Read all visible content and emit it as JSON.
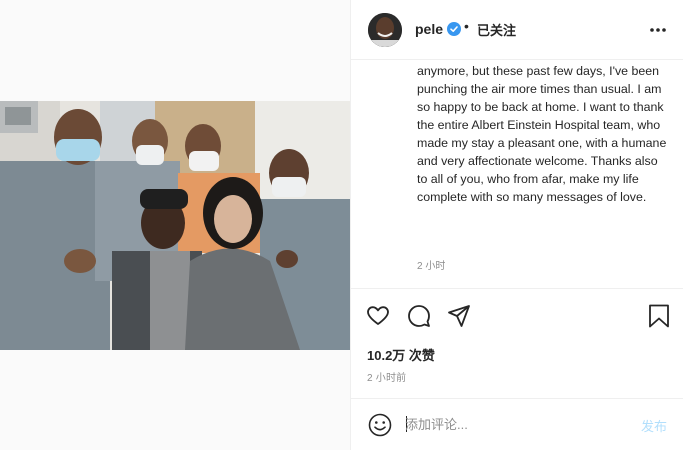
{
  "header": {
    "username": "pele",
    "separator": "•",
    "follow_status": "已关注"
  },
  "post": {
    "caption": "anymore, but these past few days, I've been punching the air more times than usual. I am so happy to be back at home. I want to thank the entire Albert Einstein Hospital team, who made my stay a pleasant one, with a humane and very affectionate welcome. Thanks also to all of you, who from afar, make my life complete with so many messages of love.",
    "caption_time": "2 小时",
    "likes": "10.2万 次赞",
    "posted_time": "2 小时前"
  },
  "comment": {
    "placeholder": "添加评论...",
    "post_label": "发布"
  },
  "icons": {
    "verified": "verified-badge-icon",
    "more": "more-options-icon",
    "like": "heart-icon",
    "comment": "comment-bubble-icon",
    "share": "paper-plane-icon",
    "save": "bookmark-icon",
    "emoji": "emoji-smile-icon"
  },
  "colors": {
    "verified_blue": "#3897f0",
    "post_button_disabled": "#b2dffc",
    "secondary_text": "#8e8e8e"
  }
}
